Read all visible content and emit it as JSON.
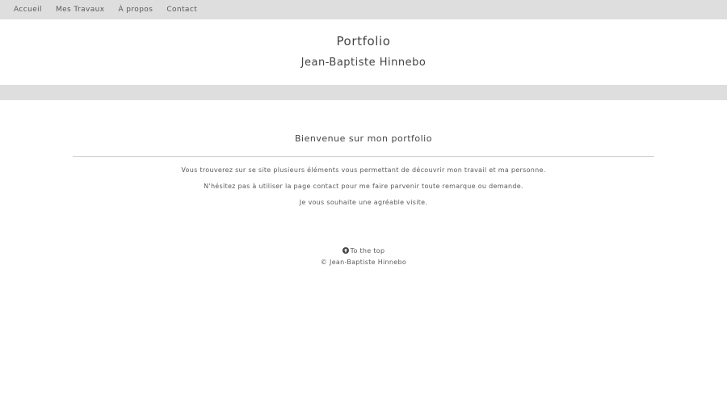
{
  "nav": {
    "items": [
      {
        "label": "Accueil"
      },
      {
        "label": "Mes Travaux"
      },
      {
        "label": "À propos"
      },
      {
        "label": "Contact"
      }
    ]
  },
  "header": {
    "title": "Portfolio",
    "subtitle": "Jean-Baptiste Hinnebo"
  },
  "main": {
    "heading": "Bienvenue sur mon portfolio",
    "paragraphs": [
      "Vous trouverez sur se site plusieurs éléments vous permettant de découvrir mon travail et ma personne.",
      "N'hésitez pas à utiliser la page contact pour me faire parvenir toute remarque ou demande.",
      "Je vous souhaite une agréable visite."
    ]
  },
  "footer": {
    "to_top_label": "To the top",
    "to_top_icon": "arrow-up-circle-icon",
    "copyright": "© Jean-Baptiste Hinnebo"
  },
  "colors": {
    "nav_background": "#dedede",
    "text": "#444444"
  }
}
